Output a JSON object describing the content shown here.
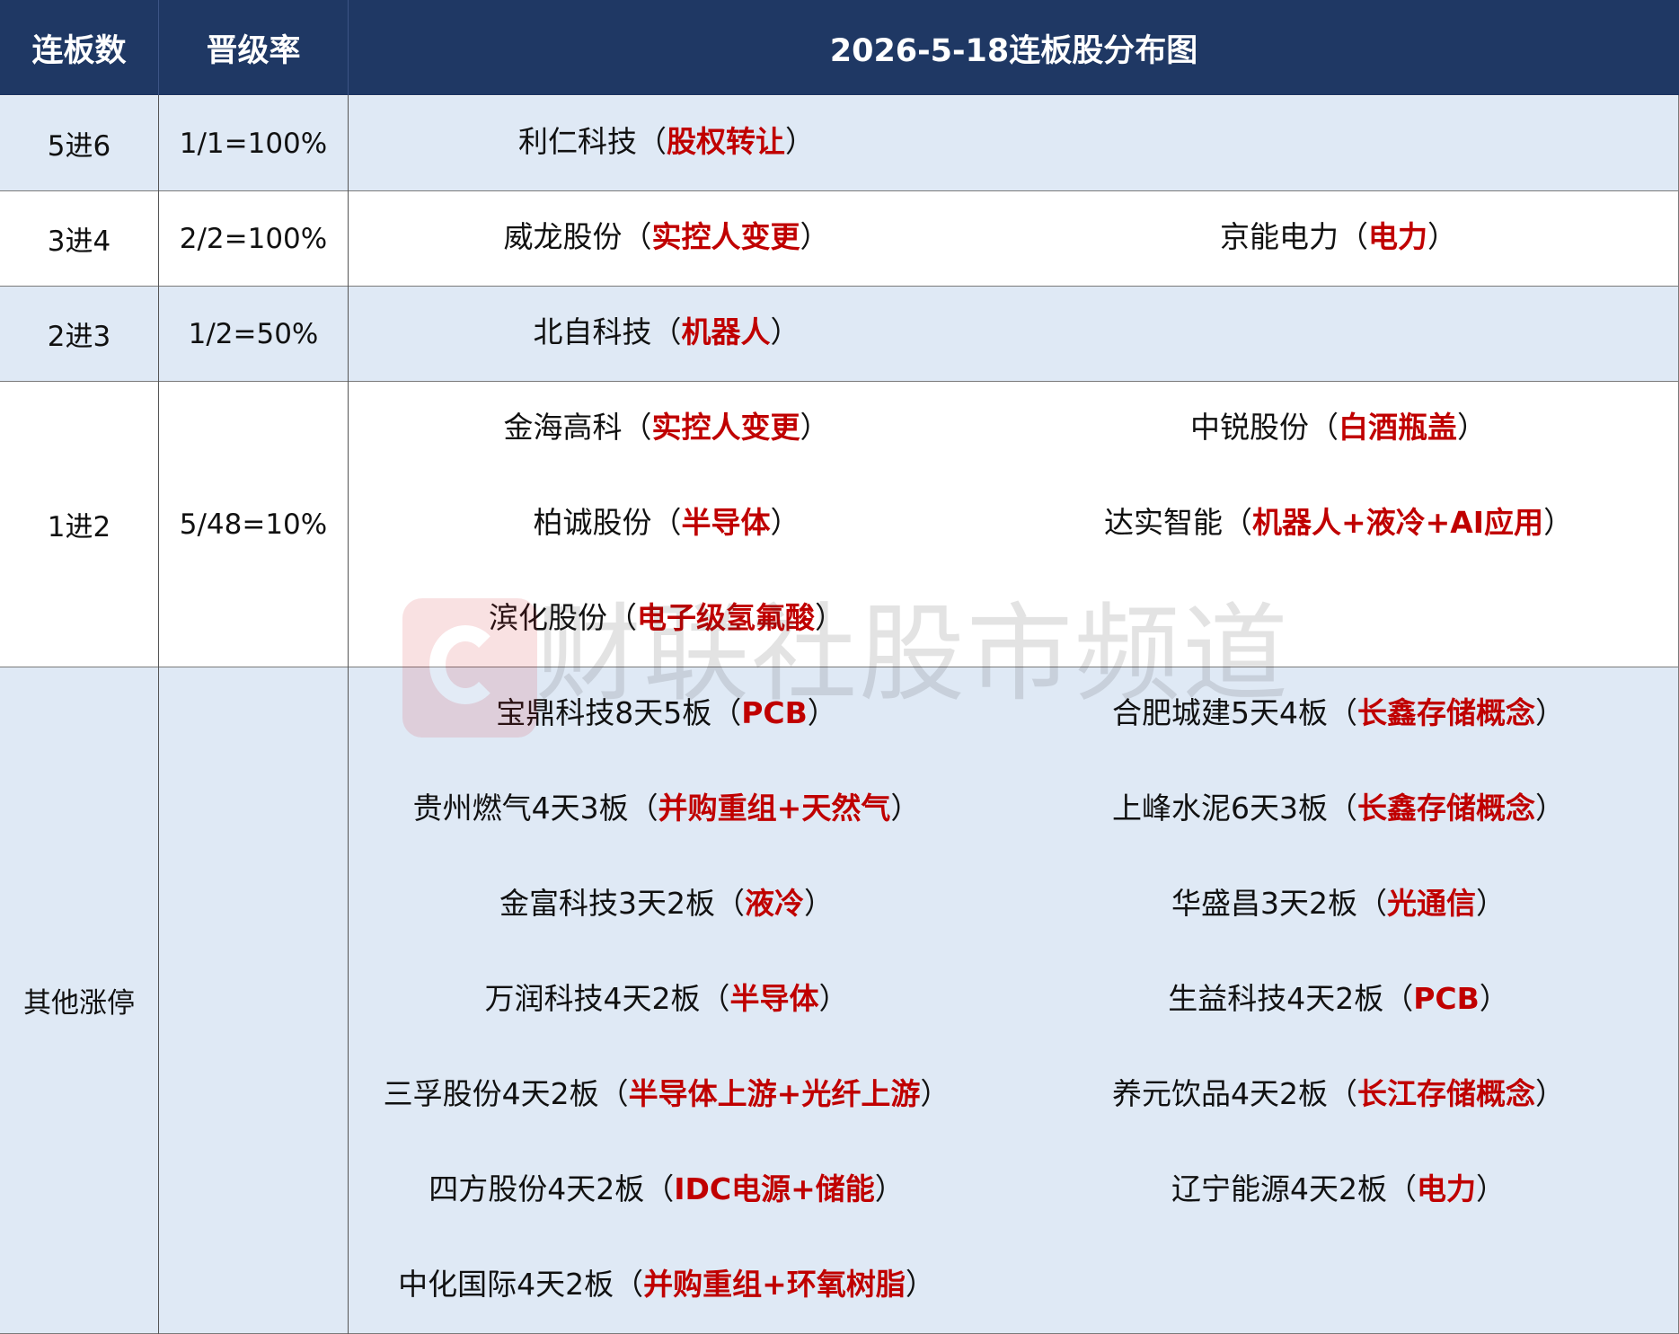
{
  "header": {
    "col1": "连板数",
    "col2": "晋级率",
    "title": "2026-5-18连板股分布图"
  },
  "rows": [
    {
      "label": "5进6",
      "rate": "1/1=100%",
      "left": [
        {
          "name": "利仁科技",
          "open": "（",
          "tag": "股权转让",
          "close": "）"
        }
      ],
      "right": []
    },
    {
      "label": "3进4",
      "rate": "2/2=100%",
      "left": [
        {
          "name": "威龙股份",
          "open": "（",
          "tag": "实控人变更",
          "close": "）"
        }
      ],
      "right": [
        {
          "name": "京能电力",
          "open": "（",
          "tag": "电力",
          "close": "）"
        }
      ]
    },
    {
      "label": "2进3",
      "rate": "1/2=50%",
      "left": [
        {
          "name": "北自科技",
          "open": "（",
          "tag": "机器人",
          "close": "）"
        }
      ],
      "right": []
    },
    {
      "label": "1进2",
      "rate": "5/48=10%",
      "left": [
        {
          "name": "金海高科",
          "open": "（",
          "tag": "实控人变更",
          "close": "）"
        },
        {
          "name": "柏诚股份",
          "open": "（",
          "tag": "半导体",
          "close": "）"
        },
        {
          "name": "滨化股份",
          "open": "（",
          "tag": "电子级氢氟酸",
          "close": "）"
        }
      ],
      "right": [
        {
          "name": "中锐股份",
          "open": "（",
          "tag": "白酒瓶盖",
          "close": "）"
        },
        {
          "name": "达实智能",
          "open": "（",
          "tag": "机器人+液冷+AI应用",
          "close": "）"
        }
      ]
    },
    {
      "label": "其他涨停",
      "rate": "",
      "left": [
        {
          "name": "宝鼎科技8天5板",
          "open": "（",
          "tag": "PCB",
          "close": "）"
        },
        {
          "name": "贵州燃气4天3板",
          "open": "（",
          "tag": "并购重组+天然气",
          "close": "）"
        },
        {
          "name": "金富科技3天2板",
          "open": "（",
          "tag": "液冷",
          "close": "）"
        },
        {
          "name": "万润科技4天2板",
          "open": "（",
          "tag": "半导体",
          "close": "）"
        },
        {
          "name": "三孚股份4天2板",
          "open": "（",
          "tag": "半导体上游+光纤上游",
          "close": "）"
        },
        {
          "name": "四方股份4天2板",
          "open": "（",
          "tag": "IDC电源+储能",
          "close": "）"
        },
        {
          "name": "中化国际4天2板",
          "open": "（",
          "tag": "并购重组+环氧树脂",
          "close": "）"
        }
      ],
      "right": [
        {
          "name": "合肥城建5天4板",
          "open": "（",
          "tag": "长鑫存储概念",
          "close": "）"
        },
        {
          "name": "上峰水泥6天3板",
          "open": "（",
          "tag": "长鑫存储概念",
          "close": "）"
        },
        {
          "name": "华盛昌3天2板",
          "open": "（",
          "tag": "光通信",
          "close": "）"
        },
        {
          "name": "生益科技4天2板",
          "open": "（",
          "tag": "PCB",
          "close": "）"
        },
        {
          "name": "养元饮品4天2板",
          "open": "（",
          "tag": "长江存储概念",
          "close": "）"
        },
        {
          "name": "辽宁能源4天2板",
          "open": "（",
          "tag": "电力",
          "close": "）"
        }
      ]
    }
  ],
  "watermark": {
    "text": "财联社股市频道",
    "icon": "cailianshe-logo-icon"
  },
  "colors": {
    "header_bg": "#1f3864",
    "row_blue": "#dfe9f5",
    "tag_red": "#c00000"
  }
}
